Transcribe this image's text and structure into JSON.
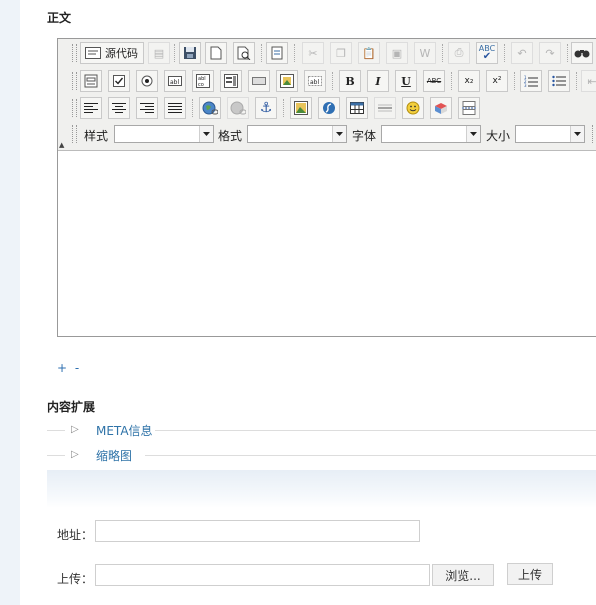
{
  "section_body": {
    "title": "正文"
  },
  "editor": {
    "toolbar": {
      "source_label": "源代码",
      "combo_labels": {
        "style": "样式",
        "format": "格式",
        "font": "字体",
        "size": "大小"
      },
      "combo_values": {
        "style": "",
        "format": "",
        "font": "",
        "size": ""
      },
      "bold": "B",
      "italic": "I",
      "underline": "U",
      "strike": "ABC",
      "subscript": "x₂",
      "superscript": "x²",
      "spellcheck": "ABC"
    },
    "content": ""
  },
  "pagination_controls": {
    "text": "+ -"
  },
  "section_extend": {
    "title": "内容扩展",
    "items": [
      {
        "label": "META信息"
      },
      {
        "label": "缩略图"
      }
    ]
  },
  "form": {
    "address_label": "地址：",
    "address_value": "",
    "upload_label": "上传：",
    "upload_value": "",
    "browse_button": "浏览...",
    "upload_button": "上传"
  }
}
